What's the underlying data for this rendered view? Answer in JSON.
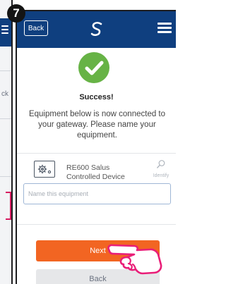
{
  "step": {
    "number": "7"
  },
  "background_screen": {
    "partial_text": "ck"
  },
  "header": {
    "back_label": "Back",
    "logo_icon": "salus-logo-icon",
    "menu_icon": "hamburger-menu-icon",
    "bar_color": "#0f3f7f"
  },
  "status": {
    "icon": "check-icon",
    "icon_color": "#67b346",
    "title": "Success!",
    "message": "Equipment below is now connected to your gateway. Please name your equipment."
  },
  "device": {
    "icon": "thermostat-gear-icon",
    "name_line1": "RE600 Salus",
    "name_line2": "Controlled Device",
    "identify_icon": "magnifier-icon",
    "identify_label": "Identify"
  },
  "name_field": {
    "placeholder": "Name this equipment",
    "value": ""
  },
  "actions": {
    "next_label": "Next",
    "next_color": "#f26522",
    "back_label": "Back"
  },
  "overlay": {
    "pointer_icon": "pointing-hand-icon",
    "pointer_color": "#e91e78"
  }
}
